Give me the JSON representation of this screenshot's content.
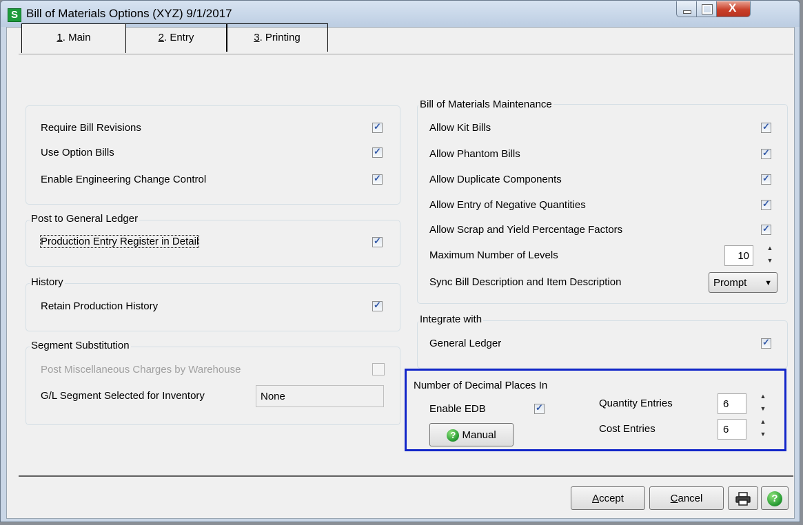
{
  "window": {
    "icon_letter": "S",
    "title": "Bill of Materials Options (XYZ) 9/1/2017",
    "close_glyph": "X"
  },
  "tabs": [
    {
      "key": "1",
      "label": ". Main"
    },
    {
      "key": "2",
      "label": ". Entry"
    },
    {
      "key": "3",
      "label": ". Printing"
    }
  ],
  "left": {
    "general": {
      "items": [
        {
          "label": "Require Bill Revisions",
          "checked": true
        },
        {
          "label": "Use Option Bills",
          "checked": true
        },
        {
          "label": "Enable Engineering Change Control",
          "checked": true
        }
      ]
    },
    "post_gl": {
      "title": "Post to General Ledger",
      "item": {
        "label": "Production Entry Register in Detail",
        "checked": true
      }
    },
    "history": {
      "title": "History",
      "item": {
        "label": "Retain Production History",
        "checked": true
      }
    },
    "segment": {
      "title": "Segment Substitution",
      "misc_label": "Post Miscellaneous Charges by Warehouse",
      "misc_checked": false,
      "gl_label": "G/L Segment Selected for Inventory",
      "gl_value": "None"
    }
  },
  "right": {
    "maintenance": {
      "title": "Bill of Materials Maintenance",
      "items": [
        {
          "label": "Allow Kit Bills",
          "checked": true
        },
        {
          "label": "Allow Phantom Bills",
          "checked": true
        },
        {
          "label": "Allow Duplicate Components",
          "checked": true
        },
        {
          "label": "Allow Entry of Negative Quantities",
          "checked": true
        },
        {
          "label": "Allow Scrap and Yield Percentage Factors",
          "checked": true
        }
      ],
      "max_levels_label": "Maximum Number of Levels",
      "max_levels_value": "10",
      "sync_label": "Sync Bill Description and Item Description",
      "sync_value": "Prompt"
    },
    "integrate": {
      "title": "Integrate with",
      "item": {
        "label": "General Ledger",
        "checked": true
      }
    },
    "decimal": {
      "title": "Number of Decimal Places In",
      "edb_label": "Enable EDB",
      "edb_checked": true,
      "manual_label": "Manual",
      "qty_label": "Quantity Entries",
      "qty_value": "6",
      "cost_label": "Cost Entries",
      "cost_value": "6"
    }
  },
  "footer": {
    "accept_key": "A",
    "accept_rest": "ccept",
    "cancel_key": "C",
    "cancel_rest": "ancel"
  },
  "colors": {
    "highlight": "#1226c9",
    "checkmark": "#3359a8",
    "title_icon": "#1e9b3b"
  },
  "icons": {
    "printer": "printer-icon",
    "help": "help-icon"
  }
}
